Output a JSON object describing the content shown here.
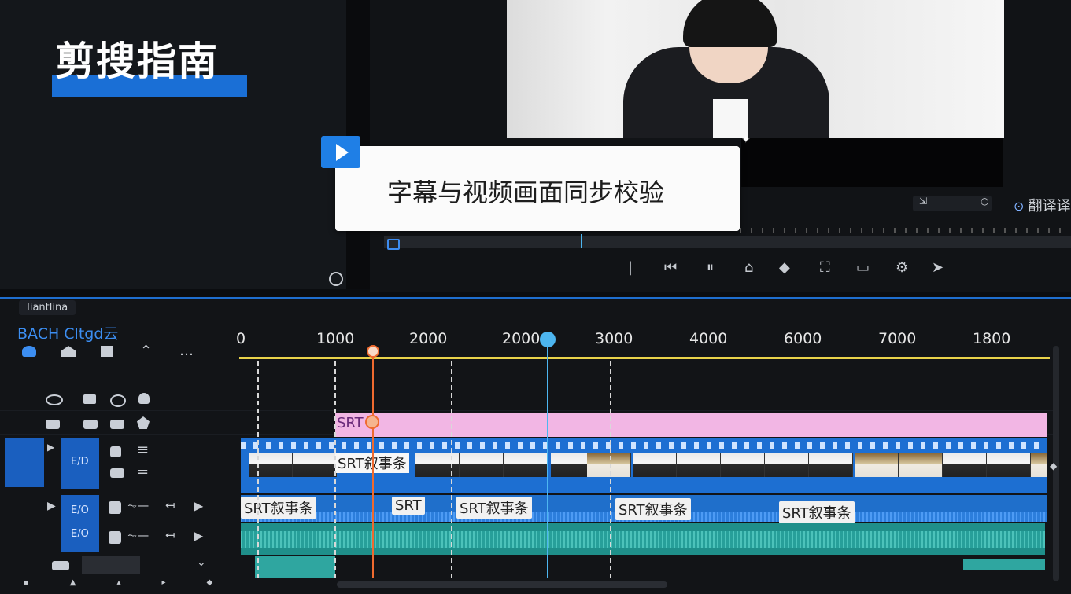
{
  "brand": {
    "title": "剪搜指南"
  },
  "callout": {
    "text": "字幕与视频画面同步校验"
  },
  "right_panel": {
    "translate_label": "翻译译"
  },
  "timeline": {
    "tab_label": "Iiantlina",
    "project_name": "BACH Cltɡd云",
    "ruler_ticks": [
      "0",
      "1000",
      "2000",
      "2000",
      "3000",
      "4000",
      "6000",
      "7000",
      "1800"
    ],
    "track_labels": {
      "srt_track": "SRT",
      "video_track_clip_label": "SRT叙事条",
      "audio_labels": [
        "SRT叙事条",
        "SRT",
        "SRT叙事条",
        "SRT叙事条",
        "SRT叙事条"
      ]
    },
    "track_buttons": [
      "E/D",
      "E/O",
      "E/O"
    ]
  },
  "colors": {
    "accent_blue": "#1f7fe6",
    "playhead_orange": "#ef6a2f",
    "playhead_blue": "#4db6f0",
    "srt_pink": "#f2b6e4",
    "ruler_yellow": "#e9d24a",
    "audio_teal": "#2fa6a0"
  }
}
